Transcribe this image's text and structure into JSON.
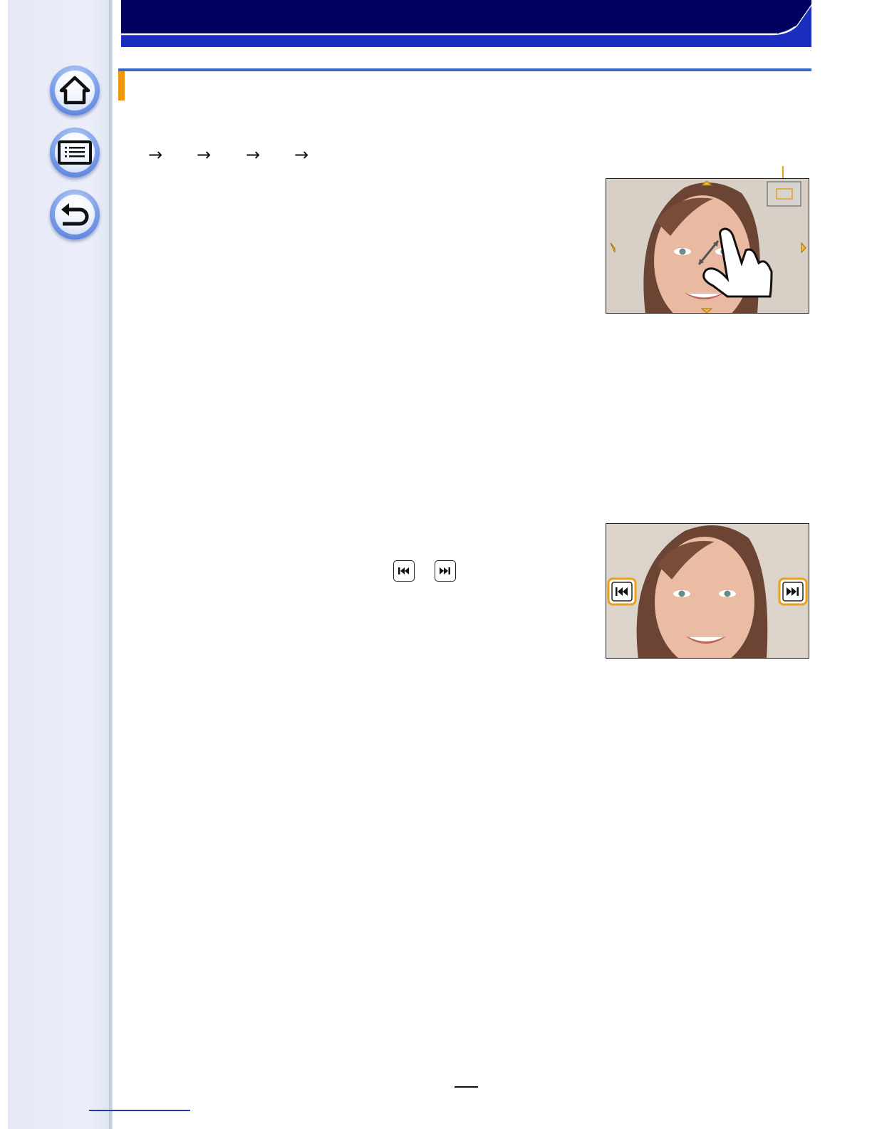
{
  "nav": {
    "home": {
      "icon": "home-icon"
    },
    "contents": {
      "icon": "contents-list-icon"
    },
    "back": {
      "icon": "return-arrow-icon"
    }
  },
  "breadcrumb": {
    "arrows": [
      "→",
      "→",
      "→",
      "→"
    ]
  },
  "figures": {
    "zoom": {
      "arrows": [
        "up-arrow-icon",
        "left-arrow-icon",
        "right-arrow-icon",
        "down-arrow-icon"
      ],
      "gesture": "pinch-hand-icon"
    },
    "skip": {
      "prev_icon": "skip-previous-icon",
      "next_icon": "skip-next-icon"
    }
  },
  "colors": {
    "header": "#00005e",
    "accent": "#f0960a",
    "title_rule": "#3a68c8",
    "highlight": "#e6a11e"
  }
}
